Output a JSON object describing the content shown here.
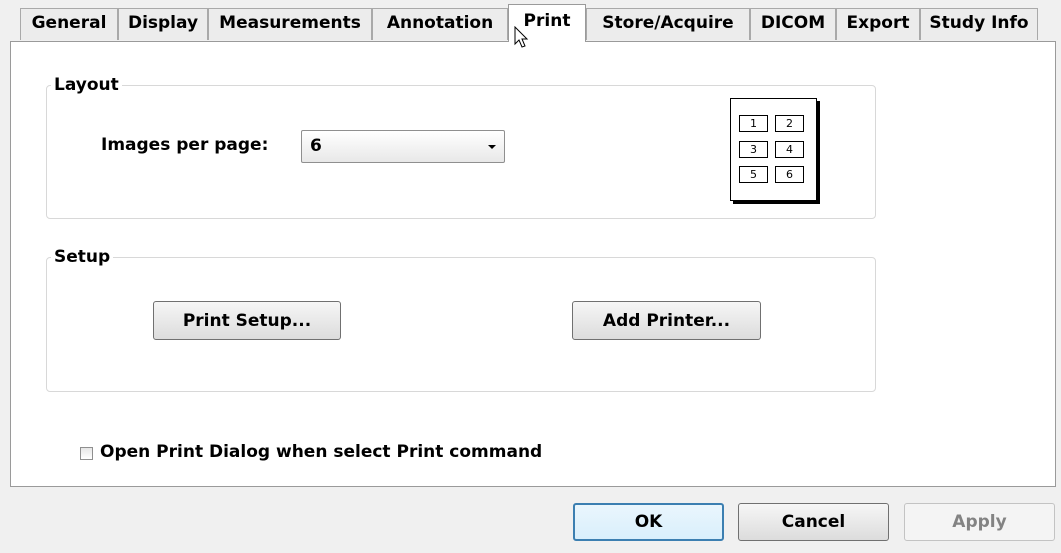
{
  "tabs": [
    {
      "label": "General"
    },
    {
      "label": "Display"
    },
    {
      "label": "Measurements"
    },
    {
      "label": "Annotation"
    },
    {
      "label": "Print"
    },
    {
      "label": "Store/Acquire"
    },
    {
      "label": "DICOM"
    },
    {
      "label": "Export"
    },
    {
      "label": "Study Info"
    }
  ],
  "active_tab": "Print",
  "layout": {
    "title": "Layout",
    "images_per_page_label": "Images per page:",
    "images_per_page_value": "6",
    "preview_cells": [
      "1",
      "2",
      "3",
      "4",
      "5",
      "6"
    ]
  },
  "setup": {
    "title": "Setup",
    "print_setup_label": "Print Setup...",
    "add_printer_label": "Add Printer..."
  },
  "open_dialog_checkbox": {
    "label": "Open Print Dialog when select Print command",
    "checked": false
  },
  "footer": {
    "ok_label": "OK",
    "cancel_label": "Cancel",
    "apply_label": "Apply"
  }
}
